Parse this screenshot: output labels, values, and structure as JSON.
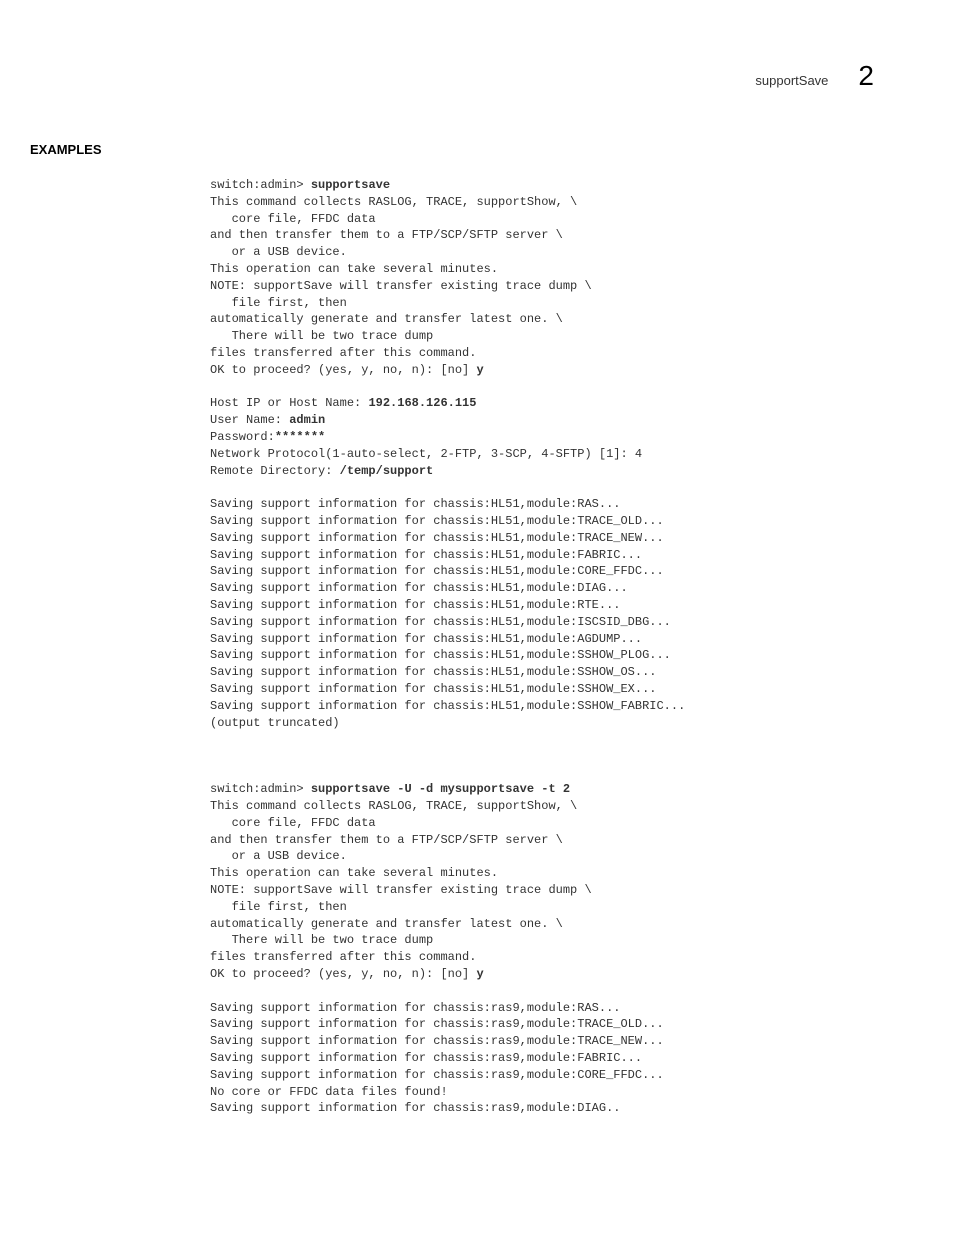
{
  "header": {
    "subtitle": "supportSave",
    "pageNumber": "2"
  },
  "section": {
    "heading": "EXAMPLES"
  },
  "block1": {
    "l01a": "switch:admin> ",
    "l01b": "supportsave",
    "l02": "This command collects RASLOG, TRACE, supportShow, \\",
    "l03": "   core file, FFDC data",
    "l04": "and then transfer them to a FTP/SCP/SFTP server \\",
    "l05": "   or a USB device.",
    "l06": "This operation can take several minutes.",
    "l07": "NOTE: supportSave will transfer existing trace dump \\",
    "l08": "   file first, then",
    "l09": "automatically generate and transfer latest one. \\",
    "l10": "   There will be two trace dump",
    "l11": "files transferred after this command.",
    "l12a": "OK to proceed? (yes, y, no, n): [no] ",
    "l12b": "y",
    "l14a": "Host IP or Host Name: ",
    "l14b": "192.168.126.115",
    "l15a": "User Name: ",
    "l15b": "admin",
    "l16a": "Password:",
    "l16b": "*******",
    "l17": "Network Protocol(1-auto-select, 2-FTP, 3-SCP, 4-SFTP) [1]: 4",
    "l18a": "Remote Directory: ",
    "l18b": "/temp/support",
    "l20": "Saving support information for chassis:HL51,module:RAS...",
    "l21": "Saving support information for chassis:HL51,module:TRACE_OLD...",
    "l22": "Saving support information for chassis:HL51,module:TRACE_NEW...",
    "l23": "Saving support information for chassis:HL51,module:FABRIC...",
    "l24": "Saving support information for chassis:HL51,module:CORE_FFDC...",
    "l25": "Saving support information for chassis:HL51,module:DIAG...",
    "l26": "Saving support information for chassis:HL51,module:RTE...",
    "l27": "Saving support information for chassis:HL51,module:ISCSID_DBG...",
    "l28": "Saving support information for chassis:HL51,module:AGDUMP...",
    "l29": "Saving support information for chassis:HL51,module:SSHOW_PLOG...",
    "l30": "Saving support information for chassis:HL51,module:SSHOW_OS...",
    "l31": "Saving support information for chassis:HL51,module:SSHOW_EX...",
    "l32": "Saving support information for chassis:HL51,module:SSHOW_FABRIC...",
    "l33": "(output truncated)"
  },
  "block2": {
    "l01a": "switch:admin> ",
    "l01b": "supportsave -U -d mysupportsave -t 2",
    "l02": "This command collects RASLOG, TRACE, supportShow, \\",
    "l03": "   core file, FFDC data",
    "l04": "and then transfer them to a FTP/SCP/SFTP server \\",
    "l05": "   or a USB device.",
    "l06": "This operation can take several minutes.",
    "l07": "NOTE: supportSave will transfer existing trace dump \\",
    "l08": "   file first, then",
    "l09": "automatically generate and transfer latest one. \\",
    "l10": "   There will be two trace dump",
    "l11": "files transferred after this command.",
    "l12a": "OK to proceed? (yes, y, no, n): [no] ",
    "l12b": "y",
    "l14": "Saving support information for chassis:ras9,module:RAS...",
    "l15": "Saving support information for chassis:ras9,module:TRACE_OLD...",
    "l16": "Saving support information for chassis:ras9,module:TRACE_NEW...",
    "l17": "Saving support information for chassis:ras9,module:FABRIC...",
    "l18": "Saving support information for chassis:ras9,module:CORE_FFDC...",
    "l19": "No core or FFDC data files found!",
    "l20": "Saving support information for chassis:ras9,module:DIAG.."
  }
}
